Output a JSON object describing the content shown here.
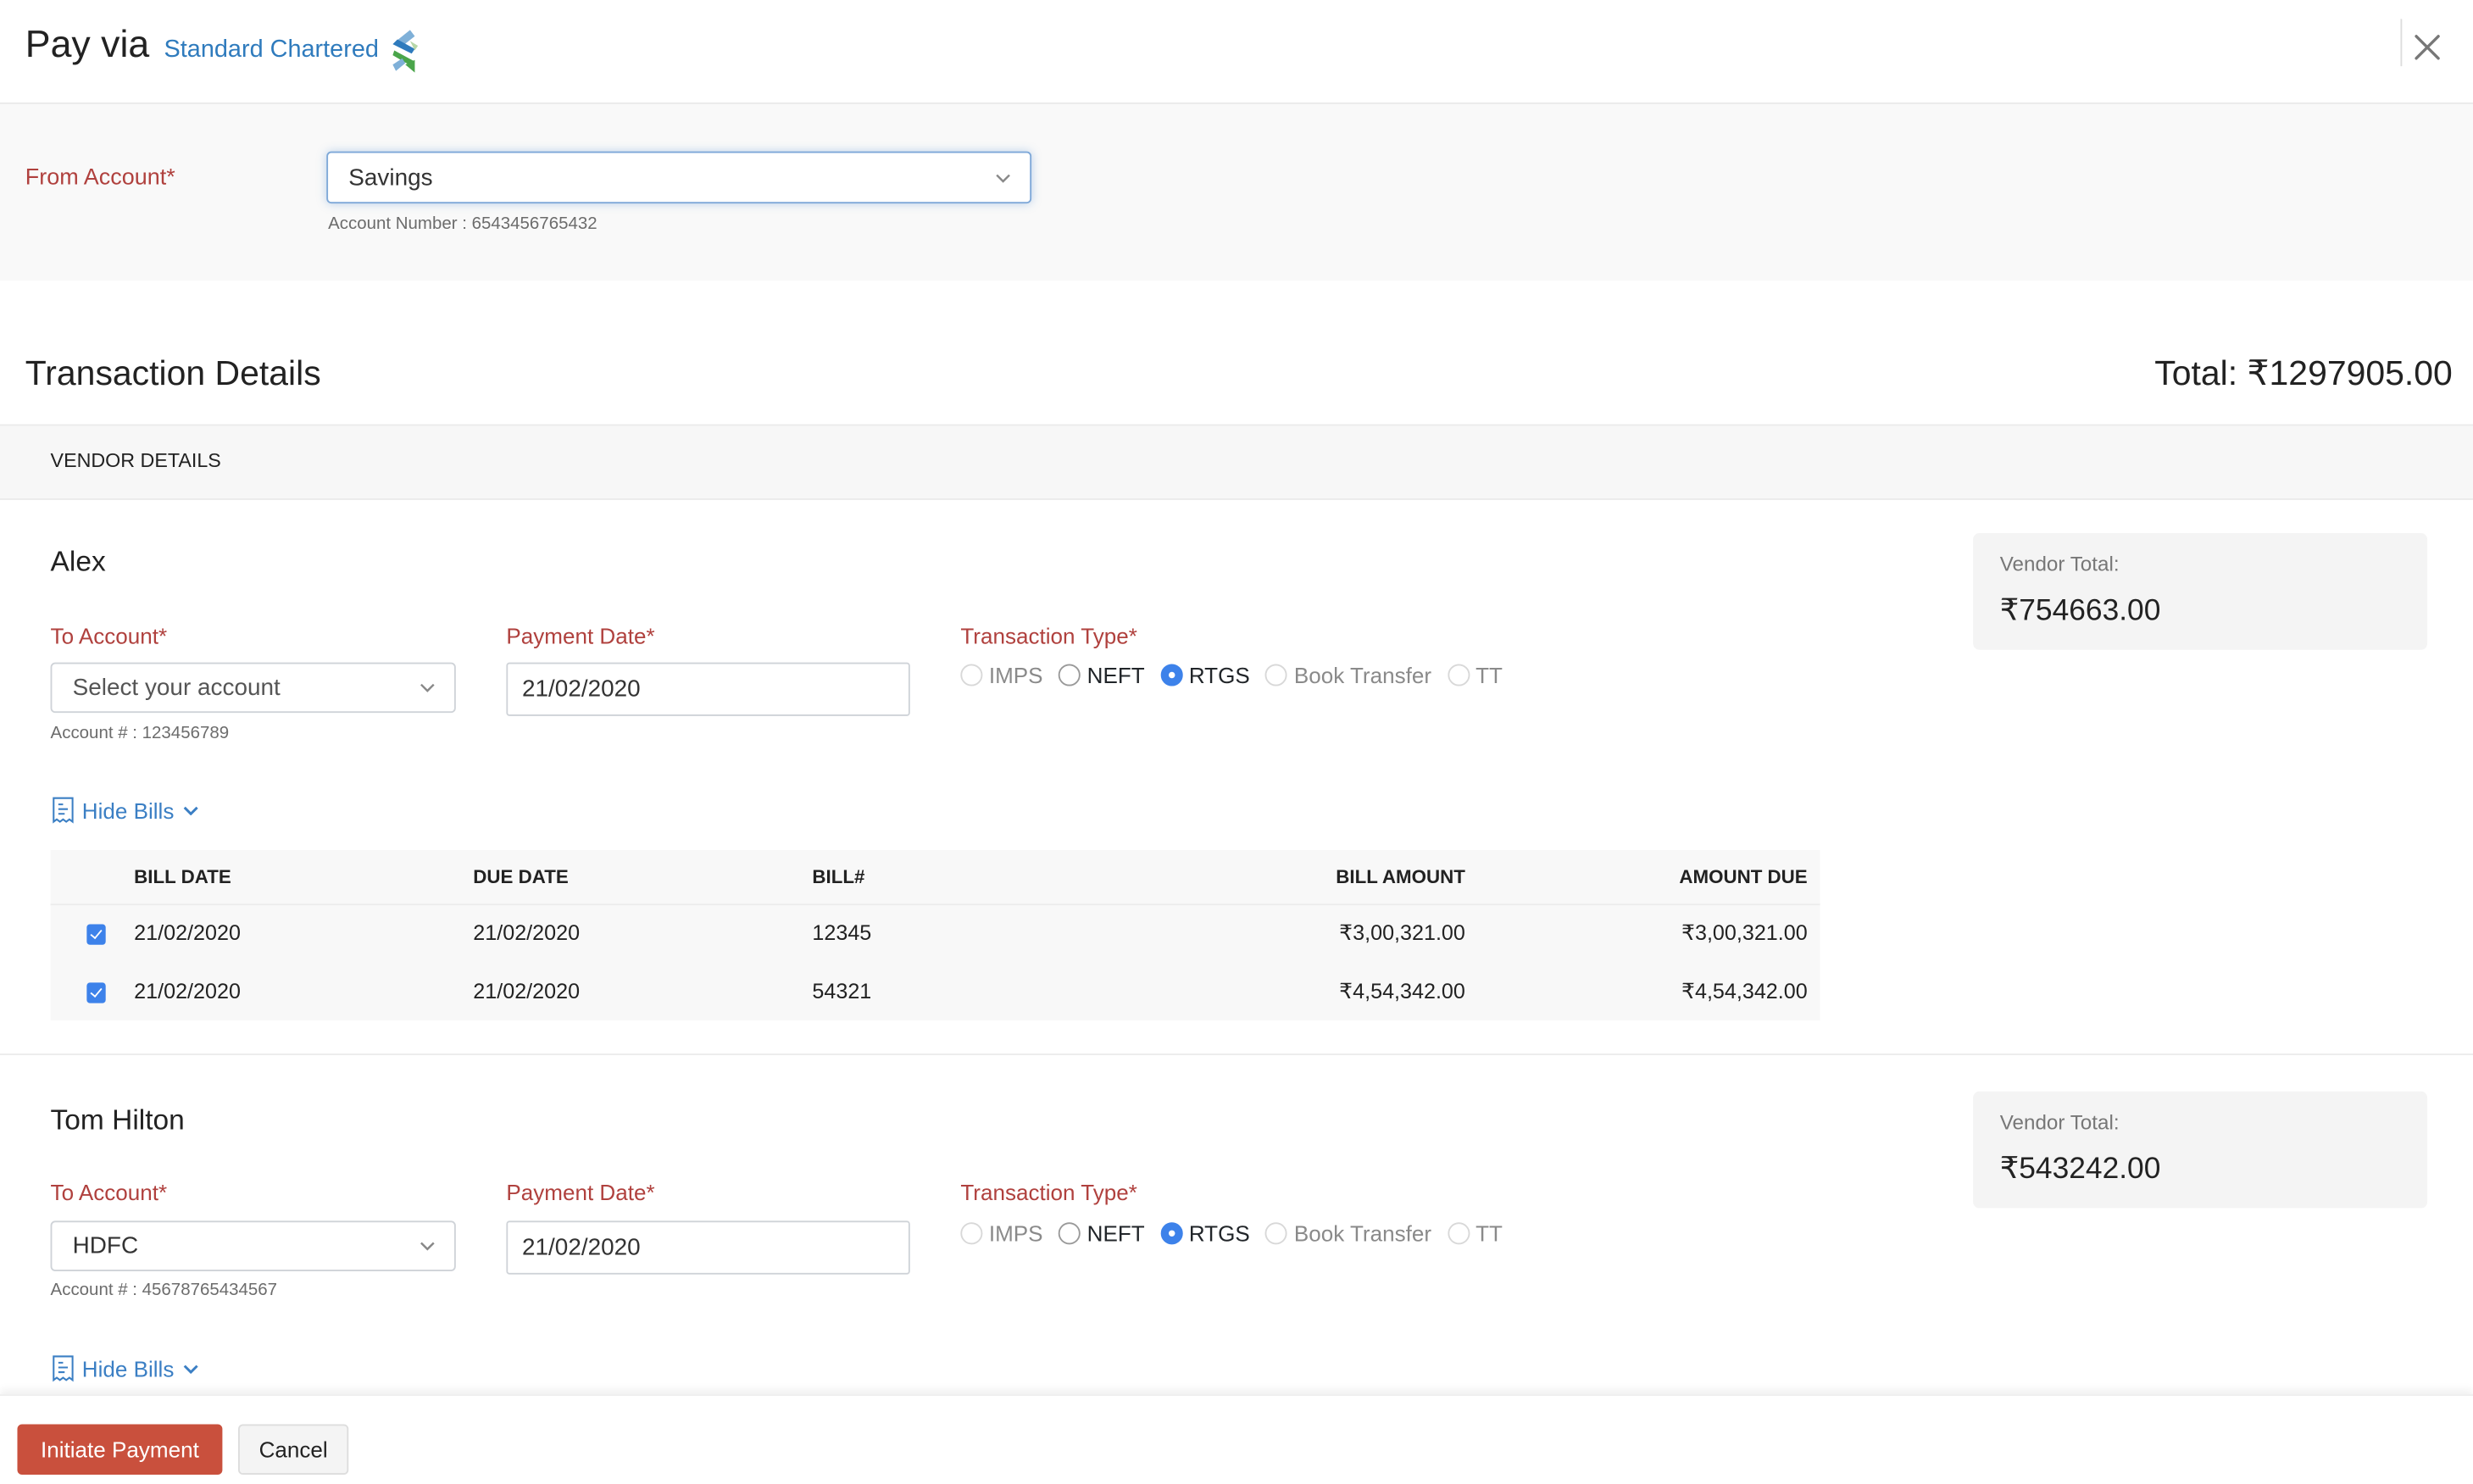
{
  "header": {
    "title": "Pay via",
    "bank_name": "Standard Chartered",
    "logo_icon": "standard-chartered-logo",
    "close_icon": "close-icon"
  },
  "from_account": {
    "label": "From Account*",
    "selected": "Savings",
    "account_number_text": "Account Number : 6543456765432"
  },
  "transaction": {
    "title": "Transaction Details",
    "total_label": "Total: ₹1297905.00",
    "vendor_details_header": "VENDOR DETAILS"
  },
  "vendors": [
    {
      "name": "Alex",
      "to_account_label": "To Account*",
      "to_account_value": "Select your account",
      "to_account_is_placeholder": true,
      "account_text": "Account # : 123456789",
      "payment_date_label": "Payment Date*",
      "payment_date": "21/02/2020",
      "transaction_type_label": "Transaction Type*",
      "transaction_types": [
        {
          "label": "IMPS",
          "disabled": true,
          "checked": false
        },
        {
          "label": "NEFT",
          "disabled": false,
          "checked": false
        },
        {
          "label": "RTGS",
          "disabled": false,
          "checked": true
        },
        {
          "label": "Book Transfer",
          "disabled": true,
          "checked": false
        },
        {
          "label": "TT",
          "disabled": true,
          "checked": false
        }
      ],
      "vendor_total_label": "Vendor Total:",
      "vendor_total": "₹754663.00",
      "hide_bills_label": "Hide Bills",
      "bills": {
        "columns": [
          "BILL DATE",
          "DUE DATE",
          "BILL#",
          "BILL AMOUNT",
          "AMOUNT DUE"
        ],
        "rows": [
          {
            "checked": true,
            "bill_date": "21/02/2020",
            "due_date": "21/02/2020",
            "bill_no": "12345",
            "bill_amount": "₹3,00,321.00",
            "amount_due": "₹3,00,321.00"
          },
          {
            "checked": true,
            "bill_date": "21/02/2020",
            "due_date": "21/02/2020",
            "bill_no": "54321",
            "bill_amount": "₹4,54,342.00",
            "amount_due": "₹4,54,342.00"
          }
        ]
      }
    },
    {
      "name": "Tom Hilton",
      "to_account_label": "To Account*",
      "to_account_value": "HDFC",
      "to_account_is_placeholder": false,
      "account_text": "Account # : 45678765434567",
      "payment_date_label": "Payment Date*",
      "payment_date": "21/02/2020",
      "transaction_type_label": "Transaction Type*",
      "transaction_types": [
        {
          "label": "IMPS",
          "disabled": true,
          "checked": false
        },
        {
          "label": "NEFT",
          "disabled": false,
          "checked": false
        },
        {
          "label": "RTGS",
          "disabled": false,
          "checked": true
        },
        {
          "label": "Book Transfer",
          "disabled": true,
          "checked": false
        },
        {
          "label": "TT",
          "disabled": true,
          "checked": false
        }
      ],
      "vendor_total_label": "Vendor Total:",
      "vendor_total": "₹543242.00",
      "hide_bills_label": "Hide Bills"
    }
  ],
  "footer": {
    "primary_label": "Initiate Payment",
    "cancel_label": "Cancel"
  },
  "colors": {
    "label_red": "#b0413e",
    "link_blue": "#3b7fc4",
    "primary_button": "#c9503d",
    "radio_checked": "#3d82ea"
  }
}
